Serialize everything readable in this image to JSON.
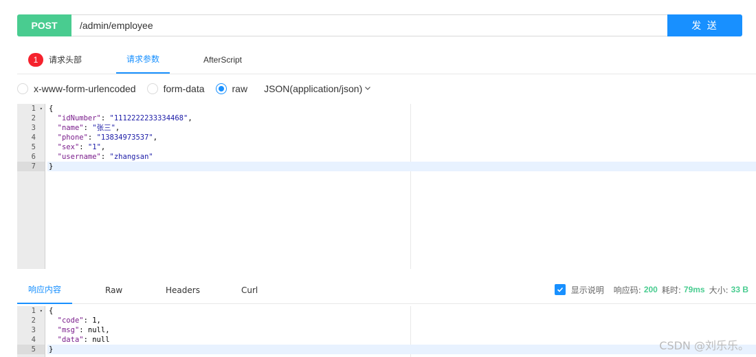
{
  "request": {
    "method": "POST",
    "url": "/admin/employee",
    "send_label": "发 送"
  },
  "request_tabs": [
    {
      "label": "请求头部",
      "badge": "1"
    },
    {
      "label": "请求参数"
    },
    {
      "label": "AfterScript"
    }
  ],
  "body_types": {
    "options": [
      "x-www-form-urlencoded",
      "form-data",
      "raw"
    ],
    "selected": "raw",
    "content_type": "JSON(application/json)"
  },
  "request_body": {
    "line_numbers": [
      "1",
      "2",
      "3",
      "4",
      "5",
      "6",
      "7"
    ],
    "lines": [
      "{",
      "  \"idNumber\": \"111222223333446 8\",",
      "  \"name\": \"张三\",",
      "  \"phone\": \"13834973537\",",
      "  \"sex\": \"1\",",
      "  \"username\": \"zhangsan\"",
      "}"
    ]
  },
  "response_tabs": [
    "响应内容",
    "Raw",
    "Headers",
    "Curl"
  ],
  "response_info": {
    "show_desc_label": "显示说明",
    "status_label": "响应码:",
    "status_value": "200",
    "time_label": "耗时:",
    "time_value": "79ms",
    "size_label": "大小:",
    "size_value": "33 B"
  },
  "response_body": {
    "line_numbers": [
      "1",
      "2",
      "3",
      "4",
      "5"
    ],
    "lines": [
      "{",
      "  \"code\": 1,",
      "  \"msg\": null,",
      "  \"data\": null",
      "}"
    ]
  },
  "watermark": "CSDN @刘乐乐。",
  "colors": {
    "method": "#49cc90",
    "send": "#1890ff",
    "active_tab": "#1890ff",
    "badge": "#f5222d"
  }
}
